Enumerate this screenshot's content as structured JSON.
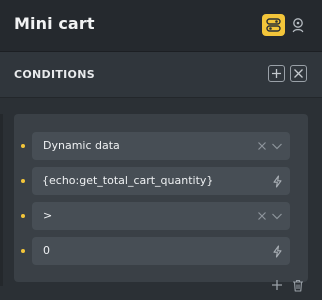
{
  "header": {
    "title": "Mini cart",
    "mode_icon": "toggle-icon",
    "user_icon": "user-icon",
    "accent_color": "#f3c53a"
  },
  "conditions": {
    "title": "CONDITIONS",
    "add_icon": "plus-icon",
    "remove_icon": "close-icon"
  },
  "condition_rows": [
    {
      "value": "Dynamic data",
      "icons": [
        "clear-icon",
        "chevron-down-icon"
      ]
    },
    {
      "value": "{echo:get_total_cart_quantity}",
      "icons": [
        "dynamic-data-bolt-icon"
      ]
    },
    {
      "value": ">",
      "icons": [
        "clear-icon",
        "chevron-down-icon"
      ]
    },
    {
      "value": "0",
      "icons": [
        "dynamic-data-bolt-icon"
      ]
    }
  ],
  "footer": {
    "add_icon": "plus-icon",
    "delete_icon": "trash-icon"
  }
}
